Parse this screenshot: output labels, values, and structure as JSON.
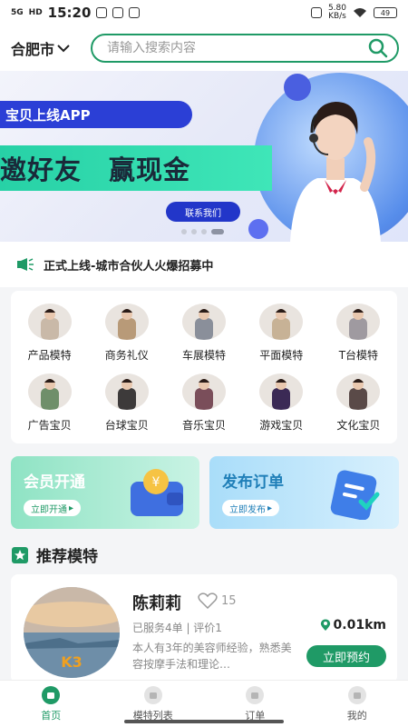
{
  "status_bar": {
    "time": "15:20",
    "network": "5G",
    "hd": "HD",
    "speed": "5.80",
    "speed_unit": "KB/s",
    "battery": "49"
  },
  "header": {
    "city": "合肥市",
    "search_placeholder": "请输入搜索内容"
  },
  "banner": {
    "app_title": "宝贝上线APP",
    "headline": "邀好友　赢现金",
    "contact_button": "联系我们",
    "slide_count": 4,
    "active_slide": 4
  },
  "notice": {
    "text": "正式上线-城市合伙人火爆招募中"
  },
  "categories": [
    {
      "label": "产品模特",
      "tone": "#c9b9a8"
    },
    {
      "label": "商务礼仪",
      "tone": "#b89a78"
    },
    {
      "label": "车展模特",
      "tone": "#8a8f9a"
    },
    {
      "label": "平面模特",
      "tone": "#c7b296"
    },
    {
      "label": "T台模特",
      "tone": "#9f9aa0"
    },
    {
      "label": "广告宝贝",
      "tone": "#6f8f6a"
    },
    {
      "label": "台球宝贝",
      "tone": "#3d3a3a"
    },
    {
      "label": "音乐宝贝",
      "tone": "#7a4e5a"
    },
    {
      "label": "游戏宝贝",
      "tone": "#3b2a55"
    },
    {
      "label": "文化宝贝",
      "tone": "#5a4a48"
    }
  ],
  "promos": {
    "member": {
      "title": "会员开通",
      "button": "立即开通"
    },
    "order": {
      "title": "发布订单",
      "button": "立即发布"
    }
  },
  "recommend": {
    "section_title": "推荐模特",
    "model": {
      "name": "陈莉莉",
      "likes": "15",
      "meta": "已服务4单 | 评价1",
      "distance": "0.01km",
      "description": "本人有3年的美容师经验，熟悉美容按摩手法和理论…",
      "book_button": "立即预约",
      "photo_caption": "K3"
    }
  },
  "tabbar": [
    {
      "label": "首页",
      "active": true
    },
    {
      "label": "模特列表",
      "active": false
    },
    {
      "label": "订单",
      "active": false
    },
    {
      "label": "我的",
      "active": false
    }
  ],
  "colors": {
    "accent": "#1f9a66",
    "banner_blue": "#2b3fd6",
    "banner_green": "#27d1a6"
  }
}
